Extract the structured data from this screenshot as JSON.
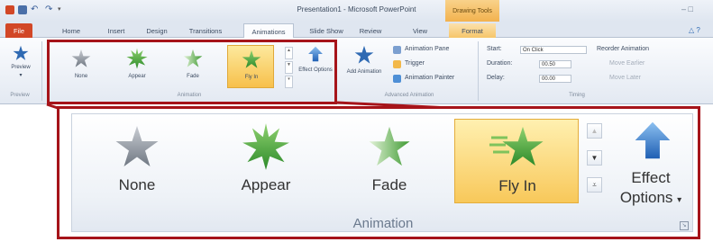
{
  "title_bar": {
    "title": "Presentation1 - Microsoft PowerPoint",
    "contextual_tab_group": "Drawing Tools",
    "window_controls": "–  □",
    "help": "△ ?"
  },
  "tabs": [
    "File",
    "Home",
    "Insert",
    "Design",
    "Transitions",
    "Animations",
    "Slide Show",
    "Review",
    "View",
    "Format"
  ],
  "ribbon": {
    "preview": {
      "label": "Preview",
      "group": "Preview"
    },
    "animation_gallery": {
      "items": [
        {
          "label": "None"
        },
        {
          "label": "Appear"
        },
        {
          "label": "Fade"
        },
        {
          "label": "Fly In",
          "selected": true
        }
      ],
      "effect_options": "Effect Options",
      "group": "Animation"
    },
    "advanced": {
      "add_animation": "Add Animation",
      "animation_pane": "Animation Pane",
      "trigger": "Trigger",
      "animation_painter": "Animation Painter",
      "group": "Advanced Animation"
    },
    "timing": {
      "start_label": "Start:",
      "start_value": "On Click",
      "duration_label": "Duration:",
      "duration_value": "00.50",
      "delay_label": "Delay:",
      "delay_value": "00.00",
      "reorder": "Reorder Animation",
      "move_earlier": "Move Earlier",
      "move_later": "Move Later",
      "group": "Timing"
    }
  },
  "zoom": {
    "items": [
      {
        "label": "None"
      },
      {
        "label": "Appear"
      },
      {
        "label": "Fade"
      },
      {
        "label": "Fly In",
        "selected": true
      }
    ],
    "effect_options_line1": "Effect",
    "effect_options_line2": "Options",
    "group_label": "Animation"
  },
  "colors": {
    "callout": "#a6141a",
    "file_tab": "#d24726",
    "selected_gallery": "#f8c85a",
    "star_green": "#3f9a32",
    "star_gray": "#8d95a0",
    "arrow_blue": "#2f79d3"
  }
}
